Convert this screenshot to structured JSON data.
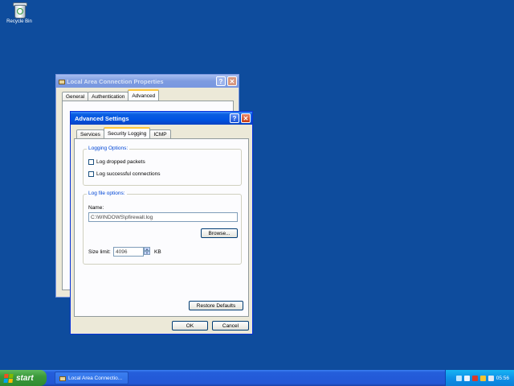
{
  "desktop": {
    "recycle_bin_label": "Recycle Bin"
  },
  "back_window": {
    "title": "Local Area Connection Properties",
    "tabs": [
      "General",
      "Authentication",
      "Advanced"
    ]
  },
  "dialog": {
    "title": "Advanced Settings",
    "tabs": [
      "Services",
      "Security Logging",
      "ICMP"
    ],
    "logging_options": {
      "group_label": "Logging Options:",
      "log_dropped": {
        "label": "Log dropped packets",
        "checked": false
      },
      "log_successful": {
        "label": "Log successful connections",
        "checked": false
      }
    },
    "log_file": {
      "group_label": "Log file options:",
      "name_label": "Name:",
      "name_value": "C:\\WINDOWS\\pfirewall.log",
      "browse_label": "Browse...",
      "size_label": "Size limit:",
      "size_value": "4096",
      "size_unit": "KB"
    },
    "restore_label": "Restore Defaults",
    "ok_label": "OK",
    "cancel_label": "Cancel"
  },
  "taskbar": {
    "start_label": "start",
    "task_label": "Local Area Connectio...",
    "clock": "05:56"
  },
  "colors": {
    "desktop": "#0e4c9d",
    "titlebar_active": "#0054e3",
    "start_green": "#3c9a3c"
  }
}
